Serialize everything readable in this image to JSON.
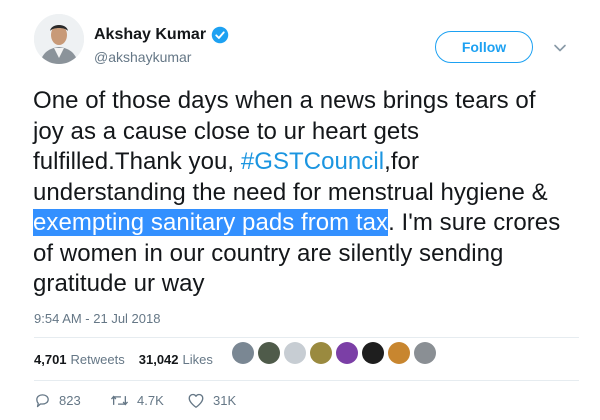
{
  "user": {
    "name": "Akshay Kumar",
    "handle": "@akshaykumar",
    "verified": true
  },
  "follow_button": {
    "label": "Follow"
  },
  "tweet": {
    "part1": "One of those days when a news brings tears of joy as a cause close to ur heart gets fulfilled.Thank you, ",
    "hashtag": "#GSTCouncil",
    "part2": ",for understanding the need for menstrual hygiene & ",
    "highlight": "exempting sanitary pads from tax",
    "part3": ". I'm sure crores of women in our country are silently sending  gratitude ur way"
  },
  "timestamp": "9:54 AM - 21 Jul 2018",
  "stats": {
    "retweets_count": "4,701",
    "retweets_label": "Retweets",
    "likes_count": "31,042",
    "likes_label": "Likes"
  },
  "liker_avatars": [
    "#7a8793",
    "#4f5b4a",
    "#c7cdd3",
    "#9a8a3f",
    "#7b3fa6",
    "#1e1e1e",
    "#c8862f",
    "#8a8f94"
  ],
  "actions": {
    "replies": "823",
    "retweets": "4.7K",
    "likes": "31K"
  },
  "colors": {
    "accent": "#1da1f2",
    "hashtag": "#1b95e0",
    "selection": "#3390ff",
    "muted": "#657786"
  }
}
